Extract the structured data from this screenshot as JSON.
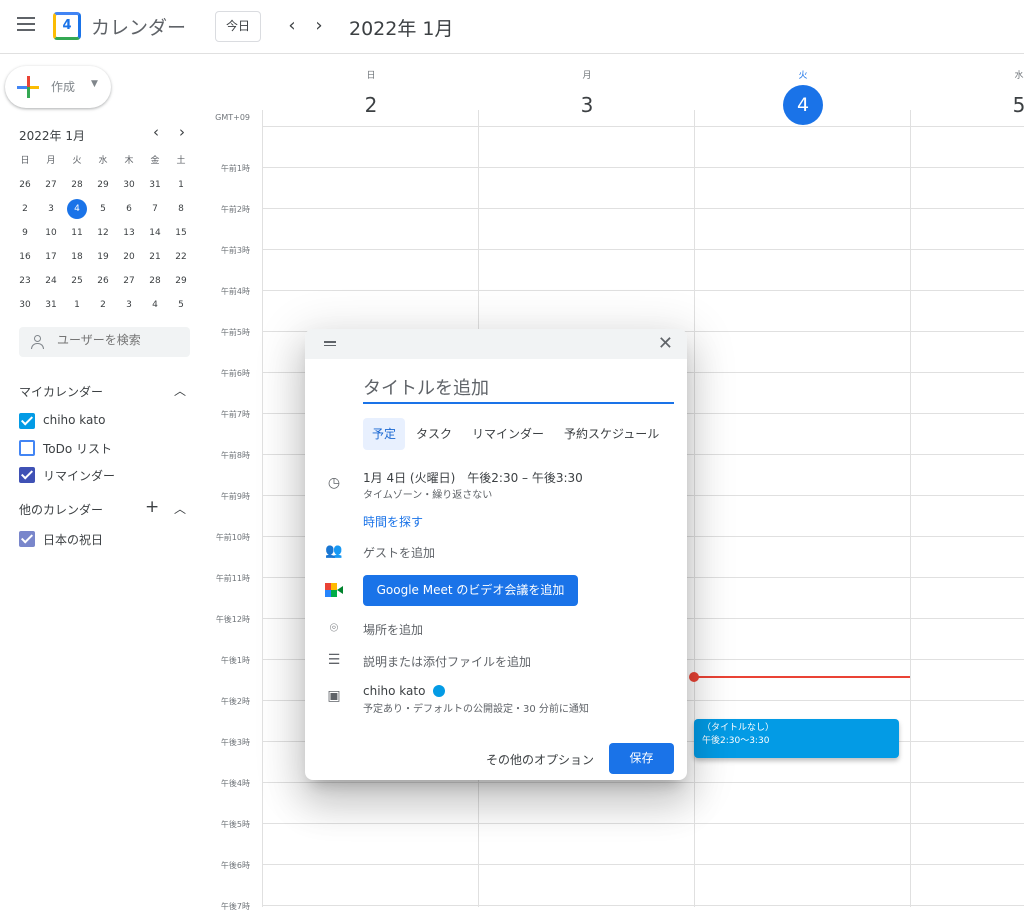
{
  "header": {
    "app_title": "カレンダー",
    "logo_day": "4",
    "today_label": "今日",
    "prev_icon": "‹",
    "next_icon": "›",
    "month_title": "2022年 1月"
  },
  "sidebar": {
    "create_label": "作成",
    "mini_title": "2022年 1月",
    "weekdays": [
      "日",
      "月",
      "火",
      "水",
      "木",
      "金",
      "土"
    ],
    "weeks": [
      [
        "26",
        "27",
        "28",
        "29",
        "30",
        "31",
        "1"
      ],
      [
        "2",
        "3",
        "4",
        "5",
        "6",
        "7",
        "8"
      ],
      [
        "9",
        "10",
        "11",
        "12",
        "13",
        "14",
        "15"
      ],
      [
        "16",
        "17",
        "18",
        "19",
        "20",
        "21",
        "22"
      ],
      [
        "23",
        "24",
        "25",
        "26",
        "27",
        "28",
        "29"
      ],
      [
        "30",
        "31",
        "1",
        "2",
        "3",
        "4",
        "5"
      ]
    ],
    "people_placeholder": "ユーザーを検索",
    "my_calendars_title": "マイカレンダー",
    "my_calendars": [
      {
        "label": "chiho kato",
        "color": "#039be5",
        "checked": true
      },
      {
        "label": "ToDo リスト",
        "color": "#4285f4",
        "checked": false
      },
      {
        "label": "リマインダー",
        "color": "#3f51b5",
        "checked": true
      }
    ],
    "other_calendars_title": "他のカレンダー",
    "other_calendars": [
      {
        "label": "日本の祝日",
        "color": "#7986cb",
        "checked": true
      }
    ]
  },
  "week": {
    "timezone": "GMT+09",
    "days": [
      {
        "dow": "日",
        "num": "2"
      },
      {
        "dow": "月",
        "num": "3"
      },
      {
        "dow": "火",
        "num": "4",
        "today": true
      },
      {
        "dow": "水",
        "num": "5"
      }
    ],
    "hours": [
      "午前1時",
      "午前2時",
      "午前3時",
      "午前4時",
      "午前5時",
      "午前6時",
      "午前7時",
      "午前8時",
      "午前9時",
      "午前10時",
      "午前11時",
      "午後12時",
      "午後1時",
      "午後2時",
      "午後3時",
      "午後4時",
      "午後5時",
      "午後6時",
      "午後7時"
    ]
  },
  "event": {
    "title": "（タイトルなし）",
    "time": "午後2:30～3:30"
  },
  "dialog": {
    "title_placeholder": "タイトルを追加",
    "tabs": [
      "予定",
      "タスク",
      "リマインダー",
      "予約スケジュール"
    ],
    "datetime": "1月 4日 (火曜日)　午後2:30 – 午後3:30",
    "datetime_sub": "タイムゾーン・繰り返さない",
    "find_time": "時間を探す",
    "add_guests": "ゲストを追加",
    "meet_button": "Google Meet のビデオ会議を追加",
    "add_location": "場所を追加",
    "add_description": "説明または添付ファイルを追加",
    "calendar_name": "chiho kato",
    "calendar_sub": "予定あり・デフォルトの公開設定・30 分前に通知",
    "more_options": "その他のオプション",
    "save": "保存"
  },
  "colors": {
    "accent": "#1a73e8",
    "event": "#039be5",
    "now_line": "#ea4335"
  }
}
